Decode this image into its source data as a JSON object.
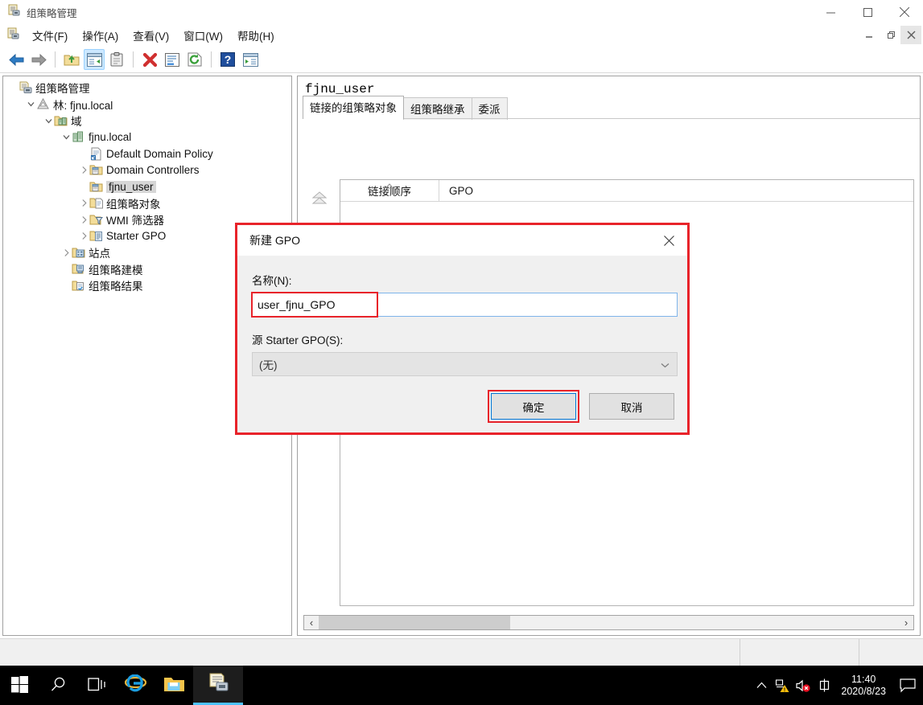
{
  "window": {
    "title": "组策略管理",
    "app_icon": "gpmc-icon",
    "controls": {
      "minimize": "minimize-icon",
      "maximize": "maximize-icon",
      "close": "close-icon"
    },
    "mdi_controls": {
      "minimize": "mdi-minimize-icon",
      "restore": "mdi-restore-icon",
      "close": "mdi-close-icon"
    }
  },
  "menu": {
    "items": [
      {
        "label": "文件(F)",
        "name": "menu-file"
      },
      {
        "label": "操作(A)",
        "name": "menu-action"
      },
      {
        "label": "查看(V)",
        "name": "menu-view"
      },
      {
        "label": "窗口(W)",
        "name": "menu-window"
      },
      {
        "label": "帮助(H)",
        "name": "menu-help"
      }
    ]
  },
  "toolbar": {
    "buttons": [
      {
        "name": "back-icon",
        "title": "后退"
      },
      {
        "name": "forward-icon",
        "title": "前进"
      },
      {
        "name": "up-folder-icon",
        "title": "向上"
      },
      {
        "name": "show-tree-icon",
        "title": "显示/隐藏控制台树",
        "active": true
      },
      {
        "name": "clipboard-icon",
        "title": "属性"
      },
      {
        "name": "delete-icon",
        "title": "删除"
      },
      {
        "name": "properties-icon",
        "title": "属性"
      },
      {
        "name": "refresh-icon",
        "title": "刷新"
      },
      {
        "name": "help-icon",
        "title": "帮助"
      },
      {
        "name": "export-list-icon",
        "title": "导出列表"
      }
    ]
  },
  "tree": {
    "nodes": [
      {
        "label": "组策略管理",
        "indent": 0,
        "icon": "gpmc-icon",
        "chev": "none",
        "selected": false
      },
      {
        "label": "林: fjnu.local",
        "indent": 1,
        "icon": "forest-icon",
        "chev": "expanded",
        "selected": false
      },
      {
        "label": "域",
        "indent": 2,
        "icon": "domains-icon",
        "chev": "expanded",
        "selected": false
      },
      {
        "label": "fjnu.local",
        "indent": 3,
        "icon": "domain-icon",
        "chev": "expanded",
        "selected": false
      },
      {
        "label": "Default Domain Policy",
        "indent": 4,
        "icon": "gpo-link-icon",
        "chev": "none",
        "selected": false
      },
      {
        "label": "Domain Controllers",
        "indent": 4,
        "icon": "ou-icon",
        "chev": "collapsed",
        "selected": false
      },
      {
        "label": "fjnu_user",
        "indent": 4,
        "icon": "ou-icon",
        "chev": "none",
        "selected": true
      },
      {
        "label": "组策略对象",
        "indent": 4,
        "icon": "gpo-folder-icon",
        "chev": "collapsed",
        "selected": false
      },
      {
        "label": "WMI 筛选器",
        "indent": 4,
        "icon": "wmi-filter-icon",
        "chev": "collapsed",
        "selected": false
      },
      {
        "label": "Starter GPO",
        "indent": 4,
        "icon": "starter-gpo-icon",
        "chev": "collapsed",
        "selected": false
      },
      {
        "label": "站点",
        "indent": 3,
        "icon": "sites-icon",
        "chev": "collapsed",
        "selected": false
      },
      {
        "label": "组策略建模",
        "indent": 3,
        "icon": "gp-modeling-icon",
        "chev": "none",
        "selected": false
      },
      {
        "label": "组策略结果",
        "indent": 3,
        "icon": "gp-results-icon",
        "chev": "none",
        "selected": false
      }
    ]
  },
  "right_pane": {
    "title": "fjnu_user",
    "tabs": [
      {
        "label": "链接的组策略对象",
        "active": true
      },
      {
        "label": "组策略继承",
        "active": false
      },
      {
        "label": "委派",
        "active": false
      }
    ],
    "order_buttons": [
      {
        "name": "move-to-top-icon"
      },
      {
        "name": "move-up-icon"
      },
      {
        "name": "move-down-icon"
      }
    ],
    "list": {
      "columns": [
        "链接顺序",
        "GPO"
      ],
      "rows": [],
      "sort_column": "链接顺序",
      "sort_direction": "asc"
    },
    "hscroll": {
      "left_arrow": "chevron-left-icon",
      "right_arrow": "chevron-right-icon",
      "thumb_percent": 33
    }
  },
  "dialog": {
    "title": "新建 GPO",
    "close_icon": "close-icon",
    "name_label": "名称(N):",
    "name_value": "user_fjnu_GPO",
    "starter_label": "源 Starter GPO(S):",
    "starter_value": "(无)",
    "starter_caret": "chevron-down-icon",
    "ok_label": "确定",
    "cancel_label": "取消",
    "annotation_color": "#e8232a"
  },
  "taskbar": {
    "buttons": [
      {
        "name": "start-button",
        "icon": "windows-logo-icon"
      },
      {
        "name": "search-button",
        "icon": "search-icon"
      },
      {
        "name": "task-view-button",
        "icon": "task-view-icon"
      },
      {
        "name": "ie-button",
        "icon": "internet-explorer-icon"
      },
      {
        "name": "explorer-button",
        "icon": "file-explorer-icon"
      },
      {
        "name": "gpmc-button",
        "icon": "gpmc-icon",
        "active": true
      }
    ],
    "tray": [
      {
        "name": "show-hidden-icons",
        "icon": "chevron-up-icon"
      },
      {
        "name": "network-status",
        "icon": "network-warning-icon"
      },
      {
        "name": "volume",
        "icon": "volume-muted-icon"
      },
      {
        "name": "ime-mode",
        "icon": "ime-chinese-icon",
        "label": "中"
      }
    ],
    "clock": {
      "time": "11:40",
      "date": "2020/8/23"
    },
    "action_center": {
      "name": "action-center-icon"
    }
  },
  "colors": {
    "accent": "#0078d7",
    "annotation": "#e8232a",
    "taskbar_bg": "#000000",
    "window_bg": "#ffffff",
    "dialog_bg": "#f0f0f0"
  }
}
